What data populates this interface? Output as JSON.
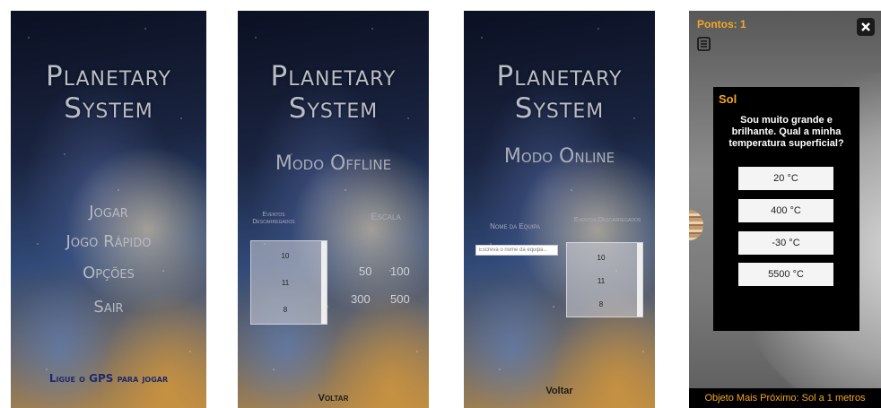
{
  "app_title": [
    "Planetary",
    "System"
  ],
  "screens": {
    "menu": {
      "items": [
        "Jogar",
        "Jogo Rápido",
        "Opções",
        "Sair"
      ],
      "gps_notice": "Ligue o GPS para jogar"
    },
    "offline": {
      "subtitle": "Modo Offline",
      "events_label": "Eventos Descarregados",
      "scale_label": "Escala",
      "events": [
        "10",
        "11",
        "8"
      ],
      "scales": [
        "50",
        "100",
        "300",
        "500"
      ],
      "back": "Voltar"
    },
    "online": {
      "subtitle": "Modo Online",
      "team_label": "Nome da Equipa",
      "team_placeholder": "Escreva o nome da equipa...",
      "events_label": "Eventos Descarregados",
      "events": [
        "10",
        "11",
        "8"
      ],
      "back": "Voltar"
    },
    "game": {
      "points": "Pontos: 1",
      "close_icon": "close-icon",
      "list_icon": "list-icon",
      "quiz": {
        "title": "Sol",
        "question": "Sou muito grande e brilhante. Qual a minha temperatura superficial?",
        "answers": [
          "20 °C",
          "400 °C",
          "-30 °C",
          "5500 °C"
        ]
      },
      "nearest": "Objeto Mais Próximo: Sol a 1 metros"
    }
  },
  "colors": {
    "accent": "#f5a623",
    "gps_text": "#1b2a6e"
  }
}
